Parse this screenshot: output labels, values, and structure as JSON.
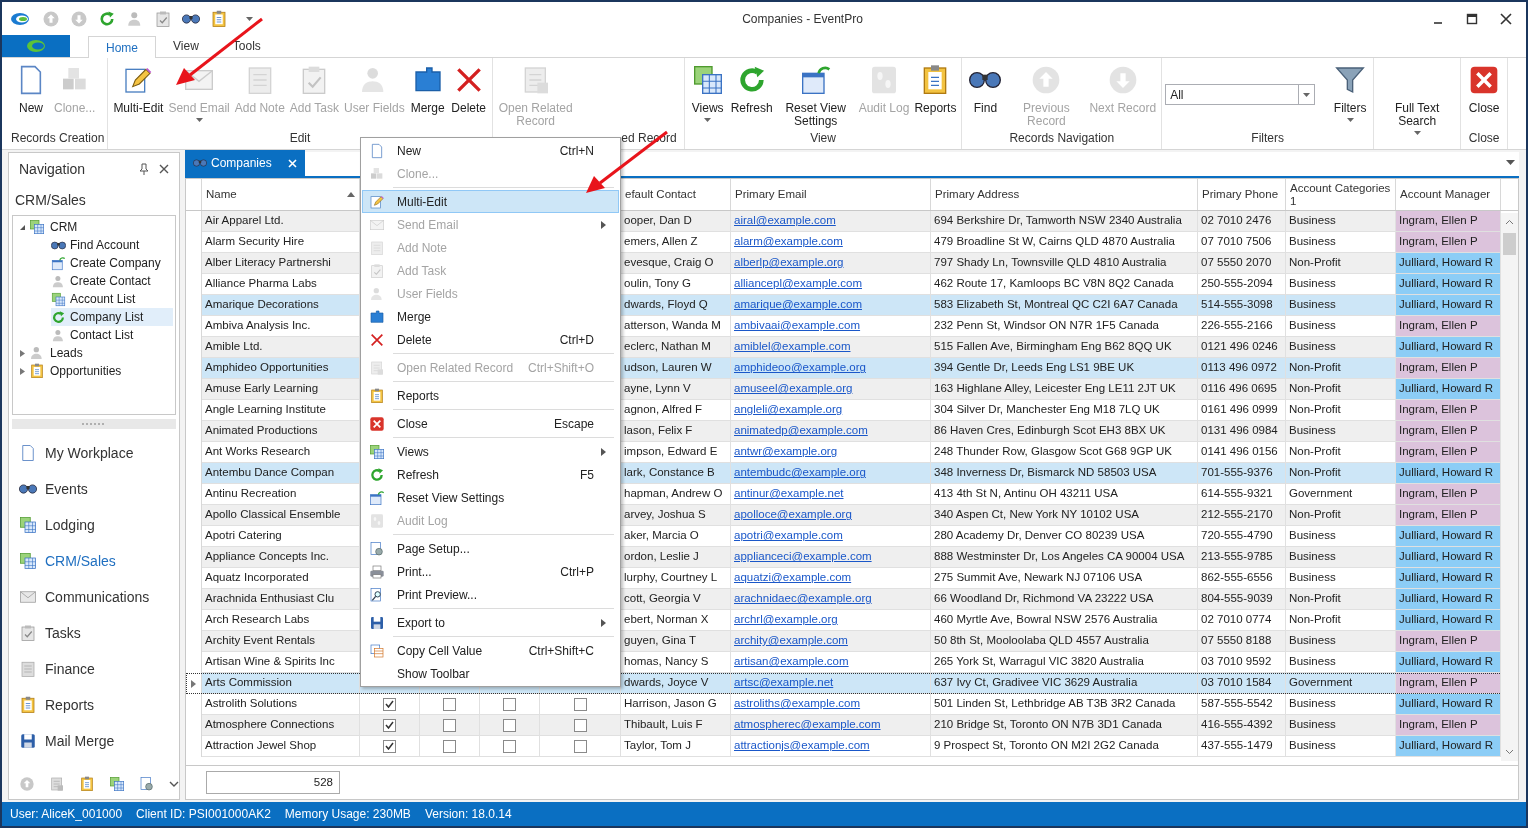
{
  "window": {
    "title": "Companies - EventPro"
  },
  "ribbon_tabs": [
    {
      "label": "Home",
      "selected": true
    },
    {
      "label": "View",
      "selected": false
    },
    {
      "label": "Tools",
      "selected": false
    }
  ],
  "ribbon_groups": [
    {
      "label": "Records Creation",
      "buttons": [
        {
          "label": "New",
          "disabled": false,
          "dropdown": false
        },
        {
          "label": "Clone...",
          "disabled": true,
          "dropdown": false
        }
      ]
    },
    {
      "label": "Edit",
      "buttons": [
        {
          "label": "Multi-Edit",
          "disabled": false,
          "dropdown": false
        },
        {
          "label": "Send Email",
          "disabled": true,
          "dropdown": true
        },
        {
          "label": "Add Note",
          "disabled": true,
          "dropdown": false
        },
        {
          "label": "Add Task",
          "disabled": true,
          "dropdown": false
        },
        {
          "label": "User Fields",
          "disabled": true,
          "dropdown": false
        },
        {
          "label": "Merge",
          "disabled": false,
          "dropdown": false
        },
        {
          "label": "Delete",
          "disabled": false,
          "dropdown": false
        }
      ]
    },
    {
      "label": "ed Record",
      "buttons": [
        {
          "label": "Open Related Record",
          "disabled": true,
          "dropdown": false
        }
      ]
    },
    {
      "label": "View",
      "buttons": [
        {
          "label": "Views",
          "disabled": false,
          "dropdown": true
        },
        {
          "label": "Refresh",
          "disabled": false,
          "dropdown": false
        },
        {
          "label": "Reset View Settings",
          "disabled": false,
          "dropdown": false
        },
        {
          "label": "Audit Log",
          "disabled": true,
          "dropdown": false
        },
        {
          "label": "Reports",
          "disabled": false,
          "dropdown": false
        }
      ]
    },
    {
      "label": "Records Navigation",
      "buttons": [
        {
          "label": "Find",
          "disabled": false,
          "dropdown": false
        },
        {
          "label": "Previous Record",
          "disabled": true,
          "dropdown": false
        },
        {
          "label": "Next Record",
          "disabled": true,
          "dropdown": false
        }
      ]
    },
    {
      "label": "Filters",
      "combo": {
        "value": "All"
      },
      "buttons": [
        {
          "label": "Filters",
          "disabled": false,
          "dropdown": true
        }
      ]
    },
    {
      "buttons": [
        {
          "label": "Full Text Search",
          "disabled": false,
          "dropdown": true
        }
      ]
    },
    {
      "label": "Close",
      "buttons": [
        {
          "label": "Close",
          "disabled": false,
          "dropdown": false
        }
      ]
    }
  ],
  "navigation": {
    "title": "Navigation",
    "section": "CRM/Sales",
    "tree": [
      {
        "label": "CRM",
        "expanded": true,
        "children": [
          {
            "label": "Find Account",
            "selected": false
          },
          {
            "label": "Create Company",
            "selected": false
          },
          {
            "label": "Create Contact",
            "selected": false
          },
          {
            "label": "Account List",
            "selected": false
          },
          {
            "label": "Company List",
            "selected": true
          },
          {
            "label": "Contact List",
            "selected": false
          }
        ]
      },
      {
        "label": "Leads",
        "expanded": false
      },
      {
        "label": "Opportunities",
        "expanded": false
      }
    ],
    "modules": [
      {
        "label": "My Workplace",
        "selected": false
      },
      {
        "label": "Events",
        "selected": false
      },
      {
        "label": "Lodging",
        "selected": false
      },
      {
        "label": "CRM/Sales",
        "selected": true
      },
      {
        "label": "Communications",
        "selected": false
      },
      {
        "label": "Tasks",
        "selected": false
      },
      {
        "label": "Finance",
        "selected": false
      },
      {
        "label": "Reports",
        "selected": false
      },
      {
        "label": "Mail Merge",
        "selected": false
      }
    ]
  },
  "document_tab": {
    "label": "Companies"
  },
  "table": {
    "columns": [
      {
        "label": "Name",
        "sorted": true
      },
      {
        "label": "efault Contact"
      },
      {
        "label": "Primary Email"
      },
      {
        "label": "Primary Address"
      },
      {
        "label": "Primary Phone"
      },
      {
        "label": "Account Categories 1"
      },
      {
        "label": "Account Manager"
      }
    ],
    "rows": [
      {
        "name": "Air Apparel Ltd.",
        "contact": "ooper, Dan D",
        "email": "airal@example.com",
        "address": "694 Berkshire Dr, Tamworth NSW 2340 Australia",
        "phone": "02 7010 2476",
        "category": "Business",
        "manager": "Ingram, Ellen P",
        "color": "#dcc3dc",
        "selected": false,
        "focused": false
      },
      {
        "name": "Alarm Security Hire",
        "contact": "emers, Allen Z",
        "email": "alarm@example.com",
        "address": "479 Broadline St W, Cairns QLD 4870 Australia",
        "phone": "07 7010 7506",
        "category": "Business",
        "manager": "Ingram, Ellen P",
        "color": "#dcc3dc",
        "selected": false,
        "focused": false
      },
      {
        "name": "Alber Literacy Partnershi",
        "contact": "evesque, Craig O",
        "email": "alberlp@example.org",
        "address": "797 Shady Ln, Townsville QLD 4810 Australia",
        "phone": "07 5550 2070",
        "category": "Non-Profit",
        "manager": "Julliard, Howard R",
        "color": "#8ccdf6",
        "selected": false,
        "focused": false
      },
      {
        "name": "Alliance Pharma Labs",
        "contact": "oulin, Tony G",
        "email": "alliancepl@example.com",
        "address": "462 Route 17, Kamloops BC V8N 8Q2 Canada",
        "phone": "250-555-2094",
        "category": "Business",
        "manager": "Julliard, Howard R",
        "color": "#8ccdf6",
        "selected": false,
        "focused": false
      },
      {
        "name": "Amarique Decorations",
        "contact": "dwards, Floyd Q",
        "email": "amarique@example.com",
        "address": "583 Elizabeth St, Montreal QC C2I 6A7 Canada",
        "phone": "514-555-3098",
        "category": "Business",
        "manager": "Julliard, Howard R",
        "color": "#8ccdf6",
        "selected": true,
        "focused": false
      },
      {
        "name": "Ambiva Analysis Inc.",
        "contact": "atterson, Wanda M",
        "email": "ambivaai@example.com",
        "address": "232 Penn St, Windsor ON N7R 1F5 Canada",
        "phone": "226-555-2166",
        "category": "Business",
        "manager": "Ingram, Ellen P",
        "color": "#dcc3dc",
        "selected": false,
        "focused": false
      },
      {
        "name": "Amible Ltd.",
        "contact": "eclerc, Nathan M",
        "email": "amiblel@example.com",
        "address": "515 Fallen Ave, Birmingham Eng B62 8QQ UK",
        "phone": "0121 496 0246",
        "category": "Business",
        "manager": "Julliard, Howard R",
        "color": "#8ccdf6",
        "selected": false,
        "focused": false
      },
      {
        "name": "Amphideo Opportunities",
        "contact": "udson, Lauren W",
        "email": "amphideoo@example.org",
        "address": "394 Gentle Dr, Leeds Eng LS1 9BE UK",
        "phone": "0113 496 0972",
        "category": "Non-Profit",
        "manager": "Ingram, Ellen P",
        "color": "#dcc3dc",
        "selected": true,
        "focused": false
      },
      {
        "name": "Amuse Early Learning",
        "contact": "ayne, Lynn V",
        "email": "amuseel@example.org",
        "address": "163 Highlane Alley, Leicester Eng LE11 2JT UK",
        "phone": "0116 496 0695",
        "category": "Non-Profit",
        "manager": "Julliard, Howard R",
        "color": "#8ccdf6",
        "selected": false,
        "focused": false
      },
      {
        "name": "Angle Learning Institute",
        "contact": "agnon, Alfred F",
        "email": "angleli@example.org",
        "address": "304 Silver Dr, Manchester Eng M18 7LQ UK",
        "phone": "0161 496 0999",
        "category": "Non-Profit",
        "manager": "Ingram, Ellen P",
        "color": "#dcc3dc",
        "selected": false,
        "focused": false
      },
      {
        "name": "Animated Productions",
        "contact": "lason, Felix F",
        "email": "animatedp@example.com",
        "address": "86 Haven Cres, Edinburgh Scot EH3 8BX UK",
        "phone": "0131 496 0984",
        "category": "Business",
        "manager": "Ingram, Ellen P",
        "color": "#dcc3dc",
        "selected": false,
        "focused": false
      },
      {
        "name": "Ant Works Research",
        "contact": "impson, Edward E",
        "email": "antwr@example.org",
        "address": "248 Thunder Row, Glasgow Scot G68 9GP UK",
        "phone": "0141 496 0156",
        "category": "Non-Profit",
        "manager": "Ingram, Ellen P",
        "color": "#dcc3dc",
        "selected": false,
        "focused": false
      },
      {
        "name": "Antembu Dance Compan",
        "contact": "lark, Constance B",
        "email": "antembudc@example.org",
        "address": "348 Inverness Dr, Bismarck ND 58503 USA",
        "phone": "701-555-9376",
        "category": "Non-Profit",
        "manager": "Julliard, Howard R",
        "color": "#8ccdf6",
        "selected": true,
        "focused": false
      },
      {
        "name": "Antinu Recreation",
        "contact": "hapman, Andrew O",
        "email": "antinur@example.net",
        "address": "413 4th St N, Antinu OH 43211 USA",
        "phone": "614-555-9321",
        "category": "Government",
        "manager": "Ingram, Ellen P",
        "color": "#dcc3dc",
        "selected": false,
        "focused": false
      },
      {
        "name": "Apollo Classical Ensemble",
        "contact": "arvey, Joshua S",
        "email": "apolloce@example.org",
        "address": "340 Aspen Ct, New York NY 10102 USA",
        "phone": "212-555-2170",
        "category": "Non-Profit",
        "manager": "Ingram, Ellen P",
        "color": "#dcc3dc",
        "selected": false,
        "focused": false
      },
      {
        "name": "Apotri Catering",
        "contact": "aker, Marcia O",
        "email": "apotri@example.com",
        "address": "280 Academy Dr, Denver CO 80239 USA",
        "phone": "720-555-4790",
        "category": "Business",
        "manager": "Julliard, Howard R",
        "color": "#8ccdf6",
        "selected": false,
        "focused": false
      },
      {
        "name": "Appliance Concepts Inc.",
        "contact": "ordon, Leslie J",
        "email": "applianceci@example.com",
        "address": "888 Westminster Dr, Los Angeles CA 90004 USA",
        "phone": "213-555-9785",
        "category": "Business",
        "manager": "Julliard, Howard R",
        "color": "#8ccdf6",
        "selected": false,
        "focused": false
      },
      {
        "name": "Aquatz Incorporated",
        "contact": "lurphy, Courtney L",
        "email": "aquatzi@example.com",
        "address": "275 Summit Ave, Newark NJ 07106 USA",
        "phone": "862-555-6556",
        "category": "Business",
        "manager": "Julliard, Howard R",
        "color": "#8ccdf6",
        "selected": false,
        "focused": false
      },
      {
        "name": "Arachnida Enthusiast Clu",
        "contact": "cott, Georgia V",
        "email": "arachnidaec@example.org",
        "address": "66 Woodland Dr, Richmond VA 23222 USA",
        "phone": "804-555-9039",
        "category": "Non-Profit",
        "manager": "Julliard, Howard R",
        "color": "#8ccdf6",
        "selected": false,
        "focused": false
      },
      {
        "name": "Arch Research Labs",
        "contact": "ebert, Norman X",
        "email": "archrl@example.org",
        "address": "460 Myrtle Ave, Bowral NSW 2576 Australia",
        "phone": "02 7010 0774",
        "category": "Non-Profit",
        "manager": "Julliard, Howard R",
        "color": "#8ccdf6",
        "selected": false,
        "focused": false
      },
      {
        "name": "Archity Event Rentals",
        "contact": "guyen, Gina T",
        "email": "archity@example.com",
        "address": "50 8th St, Mooloolaba QLD 4557 Australia",
        "phone": "07 5550 8188",
        "category": "Business",
        "manager": "Ingram, Ellen P",
        "color": "#dcc3dc",
        "selected": false,
        "focused": false
      },
      {
        "name": "Artisan Wine & Spirits Inc",
        "contact": "homas, Nancy S",
        "email": "artisan@example.com",
        "address": "265 York St, Warragul VIC 3820 Australia",
        "phone": "03 7010 9592",
        "category": "Business",
        "manager": "Julliard, Howard R",
        "color": "#8ccdf6",
        "selected": false,
        "focused": false
      },
      {
        "name": "Arts Commission",
        "contact": "dwards, Joyce V",
        "email": "artsc@example.net",
        "address": "637 Ivy Ct, Gradivee VIC 3629 Australia",
        "phone": "03 7010 1584",
        "category": "Government",
        "manager": "Ingram, Ellen P",
        "color": "#dcc3dc",
        "selected": true,
        "focused": true
      },
      {
        "name": "Astrolith Solutions",
        "checks": [
          true,
          false,
          false,
          false
        ],
        "contact": "Harrison, Jason G",
        "email": "astroliths@example.com",
        "address": "501 Linden St, Lethbridge AB T3B 3R2 Canada",
        "phone": "587-555-5542",
        "category": "Business",
        "manager": "Julliard, Howard R",
        "color": "#8ccdf6",
        "selected": false,
        "focused": false
      },
      {
        "name": "Atmosphere Connections",
        "checks": [
          true,
          false,
          false,
          false
        ],
        "contact": "Thibault, Luis F",
        "email": "atmospherec@example.com",
        "address": "210 Bridge St, Toronto ON N7B 3D1 Canada",
        "phone": "416-555-4392",
        "category": "Business",
        "manager": "Ingram, Ellen P",
        "color": "#dcc3dc",
        "selected": false,
        "focused": false
      },
      {
        "name": "Attraction Jewel Shop",
        "checks": [
          true,
          false,
          false,
          false
        ],
        "contact": "Taylor, Tom J",
        "email": "attractionjs@example.com",
        "address": "9 Prospect St, Toronto ON M2I 2G2 Canada",
        "phone": "437-555-1479",
        "category": "Business",
        "manager": "Julliard, Howard R",
        "color": "#8ccdf6",
        "selected": false,
        "focused": false
      }
    ],
    "footer": {
      "count": "528"
    }
  },
  "context_menu": {
    "items": [
      {
        "label": "New",
        "shortcut": "Ctrl+N",
        "disabled": false,
        "selected": false,
        "submenu": false,
        "separator_before": false
      },
      {
        "label": "Clone...",
        "disabled": true,
        "selected": false,
        "submenu": false,
        "separator_before": false
      },
      {
        "label": "Multi-Edit",
        "disabled": false,
        "selected": true,
        "submenu": false,
        "separator_before": true
      },
      {
        "label": "Send Email",
        "disabled": true,
        "selected": false,
        "submenu": true,
        "separator_before": false
      },
      {
        "label": "Add Note",
        "disabled": true,
        "selected": false,
        "submenu": false,
        "separator_before": false
      },
      {
        "label": "Add Task",
        "disabled": true,
        "selected": false,
        "submenu": false,
        "separator_before": false
      },
      {
        "label": "User Fields",
        "disabled": true,
        "selected": false,
        "submenu": false,
        "separator_before": false
      },
      {
        "label": "Merge",
        "disabled": false,
        "selected": false,
        "submenu": false,
        "separator_before": false
      },
      {
        "label": "Delete",
        "shortcut": "Ctrl+D",
        "disabled": false,
        "selected": false,
        "submenu": false,
        "separator_before": false
      },
      {
        "label": "Open Related Record",
        "shortcut": "Ctrl+Shift+O",
        "disabled": true,
        "selected": false,
        "submenu": false,
        "separator_before": true
      },
      {
        "label": "Reports",
        "disabled": false,
        "selected": false,
        "submenu": false,
        "separator_before": true
      },
      {
        "label": "Close",
        "shortcut": "Escape",
        "disabled": false,
        "selected": false,
        "submenu": false,
        "separator_before": true
      },
      {
        "label": "Views",
        "disabled": false,
        "selected": false,
        "submenu": true,
        "separator_before": true
      },
      {
        "label": "Refresh",
        "shortcut": "F5",
        "disabled": false,
        "selected": false,
        "submenu": false,
        "separator_before": false
      },
      {
        "label": "Reset View Settings",
        "disabled": false,
        "selected": false,
        "submenu": false,
        "separator_before": false
      },
      {
        "label": "Audit Log",
        "disabled": true,
        "selected": false,
        "submenu": false,
        "separator_before": false
      },
      {
        "label": "Page Setup...",
        "disabled": false,
        "selected": false,
        "submenu": false,
        "separator_before": true
      },
      {
        "label": "Print...",
        "shortcut": "Ctrl+P",
        "disabled": false,
        "selected": false,
        "submenu": false,
        "separator_before": false
      },
      {
        "label": "Print Preview...",
        "disabled": false,
        "selected": false,
        "submenu": false,
        "separator_before": false
      },
      {
        "label": "Export to",
        "disabled": false,
        "selected": false,
        "submenu": true,
        "separator_before": true
      },
      {
        "label": "Copy Cell Value",
        "shortcut": "Ctrl+Shift+C",
        "disabled": false,
        "selected": false,
        "submenu": false,
        "separator_before": true
      },
      {
        "label": "Show Toolbar",
        "disabled": false,
        "selected": false,
        "submenu": false,
        "separator_before": false
      }
    ]
  },
  "status_bar": [
    "User: AliceK_001000",
    "Client ID: PSI001000AK2",
    "Memory Usage: 230MB",
    "Version: 18.0.14"
  ]
}
